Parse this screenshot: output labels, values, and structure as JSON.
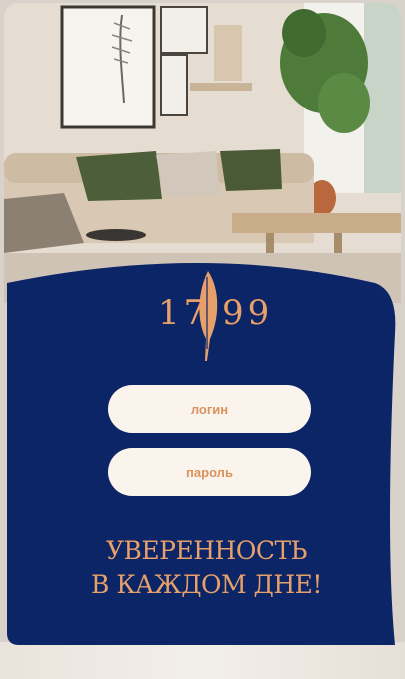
{
  "logo": {
    "left_digits": "17",
    "right_digits": "99",
    "icon": "feather-icon"
  },
  "login": {
    "placeholder": "логин"
  },
  "password": {
    "placeholder": "пароль"
  },
  "slogan": {
    "line1": "УВЕРЕННОСТЬ",
    "line2": "В КАЖДОМ ДНЕ!"
  },
  "colors": {
    "panel": "#0b2566",
    "accent": "#e8a06a",
    "field_bg": "#fbf4ed"
  }
}
